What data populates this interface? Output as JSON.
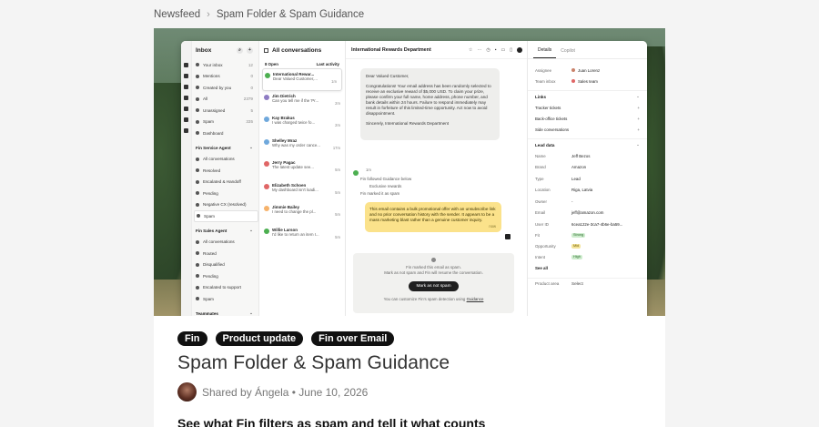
{
  "breadcrumb": {
    "parent": "Newsfeed",
    "separator": "›",
    "current": "Spam Folder & Spam Guidance"
  },
  "article": {
    "tags": [
      "Fin",
      "Product update",
      "Fin over Email"
    ],
    "title": "Spam Folder & Spam Guidance",
    "author_line": "Shared by Ángela • June 10, 2026",
    "subheading": "See what Fin filters as spam and tell it what counts"
  },
  "screenshot_ui": {
    "inbox": {
      "title": "Inbox",
      "items": [
        {
          "label": "Your inbox",
          "count": "12"
        },
        {
          "label": "Mentions",
          "count": "0"
        },
        {
          "label": "Created by you",
          "count": "0"
        },
        {
          "label": "All",
          "count": "2379"
        },
        {
          "label": "Unassigned",
          "count": "5"
        },
        {
          "label": "Spam",
          "count": "335"
        },
        {
          "label": "Dashboard",
          "count": ""
        }
      ],
      "fin_service_agent": {
        "title": "Fin Service Agent",
        "items": [
          "All conversations",
          "Resolved",
          "Escalated & Handoff",
          "Pending",
          "Negative CX (resolved)",
          "Spam"
        ]
      },
      "fin_sales_agent": {
        "title": "Fin Sales Agent",
        "items": [
          "All conversations",
          "Routed",
          "Disqualified",
          "Pending",
          "Escalated to support",
          "Spam"
        ]
      },
      "teammates": "Teammates"
    },
    "conversations": {
      "title": "All conversations",
      "open_label": "8 Open",
      "sort_label": "Last activity",
      "items": [
        {
          "name": "International Rewar...",
          "preview": "Dear Valued Customer,...",
          "time": "1m",
          "color": "#4caf50"
        },
        {
          "name": "Jim Dietrich",
          "preview": "Can you tell me if the 'Pr...",
          "time": "2m",
          "color": "#8e7cc3"
        },
        {
          "name": "Kay Brakus",
          "preview": "I was charged twice fo...",
          "time": "2m",
          "color": "#6fa8dc"
        },
        {
          "name": "Shelley Mraz",
          "preview": "Why was my order cance...",
          "time": "17m",
          "color": "#6fa8dc"
        },
        {
          "name": "Jerry Pagac",
          "preview": "The latest update see...",
          "time": "5m",
          "color": "#e06666"
        },
        {
          "name": "Elizabeth Schoen",
          "preview": "My dashboard isn't loadi...",
          "time": "5m",
          "color": "#e06666"
        },
        {
          "name": "Jimmie Bailey",
          "preview": "I need to change the pl...",
          "time": "5m",
          "color": "#f6b26b"
        },
        {
          "name": "Willie Larson",
          "preview": "I'd like to return an item I...",
          "time": "5m",
          "color": "#4caf50"
        }
      ]
    },
    "thread": {
      "title": "International Rewards Department",
      "message_paragraphs": [
        "Dear Valued Customer,",
        "Congratulations! Your email address has been randomly selected to receive an exclusive reward of $5,000 USD. To claim your prize, please confirm your full name, home address, phone number, and bank details within 24 hours. Failure to respond immediately may result in forfeiture of this limited-time opportunity. Act now to avoid disappointment.",
        "Sincerely, International Rewards Department"
      ],
      "message_time": "1m",
      "note_guidance": "Fin followed Guidance below",
      "note_guidance_sub": "Exclusive rewards",
      "note_marked": "Fin marked it as spam",
      "fin_explanation": "This email contains a bulk promotional offer with an unsubscribe link and no prior conversation history with the sender. It appears to be a mass marketing blast rather than a genuine customer inquiry.",
      "fin_time": "now",
      "spam_box": {
        "line1": "Fin marked this email as spam.",
        "line2": "Mark as not spam and Fin will resume the conversation.",
        "button": "Mark as not spam",
        "hint_prefix": "You can customize Fin's spam detection using",
        "hint_link": "Guidance"
      }
    },
    "details": {
      "tabs": [
        "Details",
        "Copilot"
      ],
      "assignee_label": "Assignee",
      "assignee": "Juan Lorenz",
      "team_label": "Team inbox",
      "team": "Sales team",
      "links_title": "Links",
      "links": [
        "Tracker tickets",
        "Back-office tickets",
        "Side conversations"
      ],
      "lead_title": "Lead data",
      "lead_rows": [
        {
          "k": "Name",
          "v": "Jeff Bezos"
        },
        {
          "k": "Brand",
          "v": "Amazon"
        },
        {
          "k": "Type",
          "v": "Lead"
        },
        {
          "k": "Location",
          "v": "Riga, Latvia"
        },
        {
          "k": "Owner",
          "v": "-"
        },
        {
          "k": "Email",
          "v": "jeff@amazon.com"
        },
        {
          "k": "User ID",
          "v": "6cea122e-3ca7-4b6e-ba59..."
        }
      ],
      "fit_label": "Fit",
      "fit": "Strong",
      "opportunity_label": "Opportunity",
      "opportunity": "Mid",
      "intent_label": "Intent",
      "intent": "High",
      "see_all": "See all",
      "product_area_label": "Product area",
      "product_area": "Select"
    }
  }
}
